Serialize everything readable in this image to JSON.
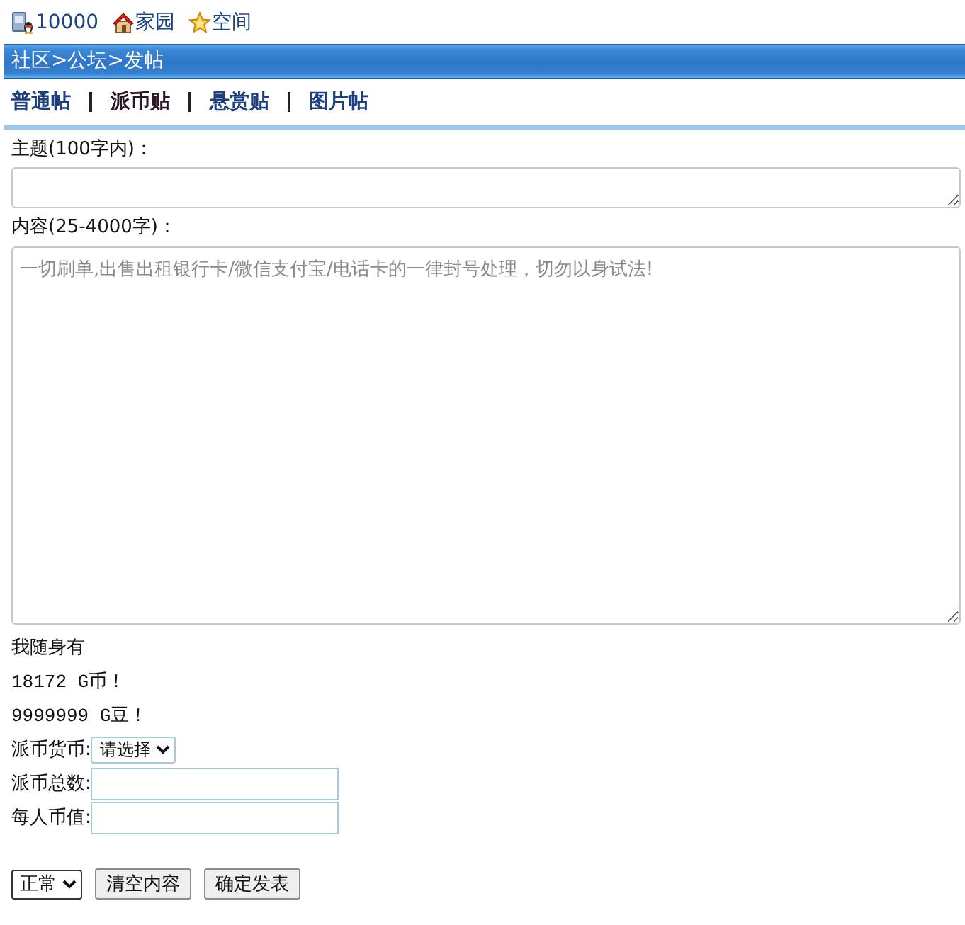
{
  "top_links": [
    {
      "kind": "device",
      "text": "10000"
    },
    {
      "kind": "home",
      "text": "家园"
    },
    {
      "kind": "star",
      "text": "空间"
    }
  ],
  "breadcrumb": "社区>公坛>发帖",
  "post_types": [
    {
      "label": "普通帖",
      "selected": false
    },
    {
      "label": "派币贴",
      "selected": true
    },
    {
      "label": "悬赏贴",
      "selected": false
    },
    {
      "label": "图片帖",
      "selected": false
    }
  ],
  "form": {
    "subject_label": "主题(100字内)：",
    "content_label": "内容(25-4000字)：",
    "content_placeholder": "一切刷单,出售出租银行卡/微信支付宝/电话卡的一律封号处理，切勿以身试法!"
  },
  "wallet": {
    "heading": "我随身有",
    "lines": [
      "18172 G币！",
      "9999999 G豆！"
    ]
  },
  "coin_fields": [
    {
      "kind": "select",
      "label": "派币货币:",
      "value": "请选择"
    },
    {
      "kind": "input",
      "label": "派币总数:"
    },
    {
      "kind": "input",
      "label": "每人币值:"
    }
  ],
  "actions": {
    "mode": "正常",
    "buttons": [
      "清空内容",
      "确定发表"
    ]
  }
}
